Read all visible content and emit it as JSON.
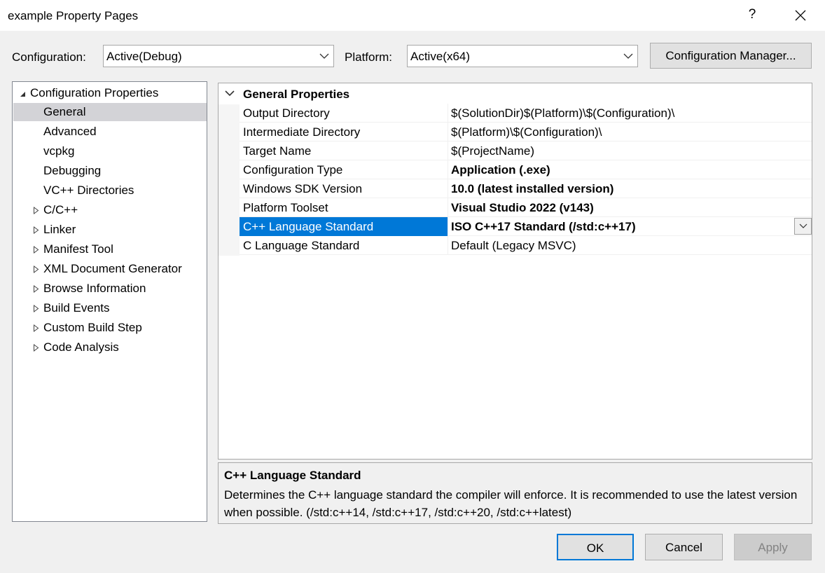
{
  "window": {
    "title": "example Property Pages",
    "help_label": "?"
  },
  "toolbar": {
    "configuration_label": "Configuration:",
    "configuration_value": "Active(Debug)",
    "platform_label": "Platform:",
    "platform_value": "Active(x64)",
    "config_manager_label": "Configuration Manager..."
  },
  "tree": {
    "root": "Configuration Properties",
    "items": [
      {
        "label": "General",
        "expandable": false,
        "selected": true
      },
      {
        "label": "Advanced",
        "expandable": false
      },
      {
        "label": "vcpkg",
        "expandable": false
      },
      {
        "label": "Debugging",
        "expandable": false
      },
      {
        "label": "VC++ Directories",
        "expandable": false
      },
      {
        "label": "C/C++",
        "expandable": true
      },
      {
        "label": "Linker",
        "expandable": true
      },
      {
        "label": "Manifest Tool",
        "expandable": true
      },
      {
        "label": "XML Document Generator",
        "expandable": true
      },
      {
        "label": "Browse Information",
        "expandable": true
      },
      {
        "label": "Build Events",
        "expandable": true
      },
      {
        "label": "Custom Build Step",
        "expandable": true
      },
      {
        "label": "Code Analysis",
        "expandable": true
      }
    ]
  },
  "grid": {
    "section_title": "General Properties",
    "rows": [
      {
        "name": "Output Directory",
        "value": "$(SolutionDir)$(Platform)\\$(Configuration)\\",
        "bold": false
      },
      {
        "name": "Intermediate Directory",
        "value": "$(Platform)\\$(Configuration)\\",
        "bold": false
      },
      {
        "name": "Target Name",
        "value": "$(ProjectName)",
        "bold": false
      },
      {
        "name": "Configuration Type",
        "value": "Application (.exe)",
        "bold": true
      },
      {
        "name": "Windows SDK Version",
        "value": "10.0 (latest installed version)",
        "bold": true
      },
      {
        "name": "Platform Toolset",
        "value": "Visual Studio 2022 (v143)",
        "bold": true
      },
      {
        "name": "C++ Language Standard",
        "value": "ISO C++17 Standard (/std:c++17)",
        "bold": true,
        "selected": true
      },
      {
        "name": "C Language Standard",
        "value": "Default (Legacy MSVC)",
        "bold": false
      }
    ]
  },
  "description": {
    "title": "C++ Language Standard",
    "text": "Determines the C++ language standard the compiler will enforce. It is recommended to use the latest version when possible.  (/std:c++14, /std:c++17, /std:c++20, /std:c++latest)"
  },
  "buttons": {
    "ok": "OK",
    "cancel": "Cancel",
    "apply": "Apply"
  },
  "colors": {
    "selection": "#0078d7",
    "tree_selection": "#d3d3d7",
    "button_face": "#e1e1e1",
    "ok_border": "#0078d7",
    "disabled_text": "#838383"
  }
}
